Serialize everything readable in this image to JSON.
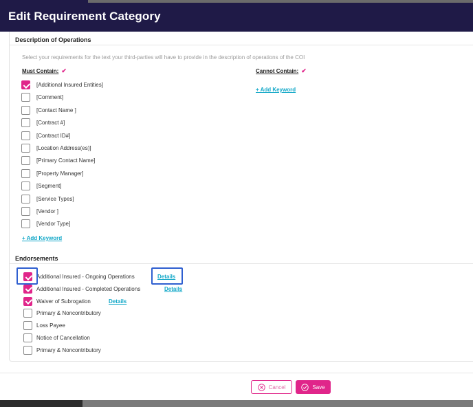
{
  "modal": {
    "title": "Edit Requirement Category"
  },
  "description": {
    "title": "Description of Operations",
    "hint": "Select your requirements for the text your third-parties will have to provide in the description of operations of the COI",
    "must_contain_label": "Must Contain:",
    "cannot_contain_label": "Cannot Contain:",
    "required_marker": "✔",
    "items": [
      {
        "label": "[Additional Insured Entities]",
        "checked": true
      },
      {
        "label": "[Comment]",
        "checked": false
      },
      {
        "label": "[Contact Name ]",
        "checked": false
      },
      {
        "label": "[Contract #]",
        "checked": false
      },
      {
        "label": "[Contract ID#]",
        "checked": false
      },
      {
        "label": "[Location Address(es)]",
        "checked": false
      },
      {
        "label": "[Primary Contact Name]",
        "checked": false
      },
      {
        "label": "[Property Manager]",
        "checked": false
      },
      {
        "label": "[Segment]",
        "checked": false
      },
      {
        "label": "[Service Types]",
        "checked": false
      },
      {
        "label": "[Vendor ]",
        "checked": false
      },
      {
        "label": "[Vendor Type]",
        "checked": false
      }
    ],
    "add_keyword_must": "+ Add Keyword",
    "add_keyword_cannot": "+ Add Keyword"
  },
  "endorsements": {
    "title": "Endorsements",
    "items": [
      {
        "label": "Additional Insured - Ongoing Operations",
        "checked": true,
        "details": "Details"
      },
      {
        "label": "Additional Insured - Completed Operations",
        "checked": true,
        "details": "Details"
      },
      {
        "label": "Waiver of Subrogation",
        "checked": true,
        "details": "Details"
      },
      {
        "label": "Primary & Noncontributory",
        "checked": false
      },
      {
        "label": "Loss Payee",
        "checked": false
      },
      {
        "label": "Notice of Cancellation",
        "checked": false
      },
      {
        "label": "Primary & Noncontributory",
        "checked": false
      }
    ]
  },
  "footer": {
    "cancel_label": "Cancel",
    "save_label": "Save"
  },
  "colors": {
    "header": "#1f1a47",
    "accent": "#e0258a",
    "link": "#13a8c8",
    "highlight": "#2f5fd0"
  }
}
